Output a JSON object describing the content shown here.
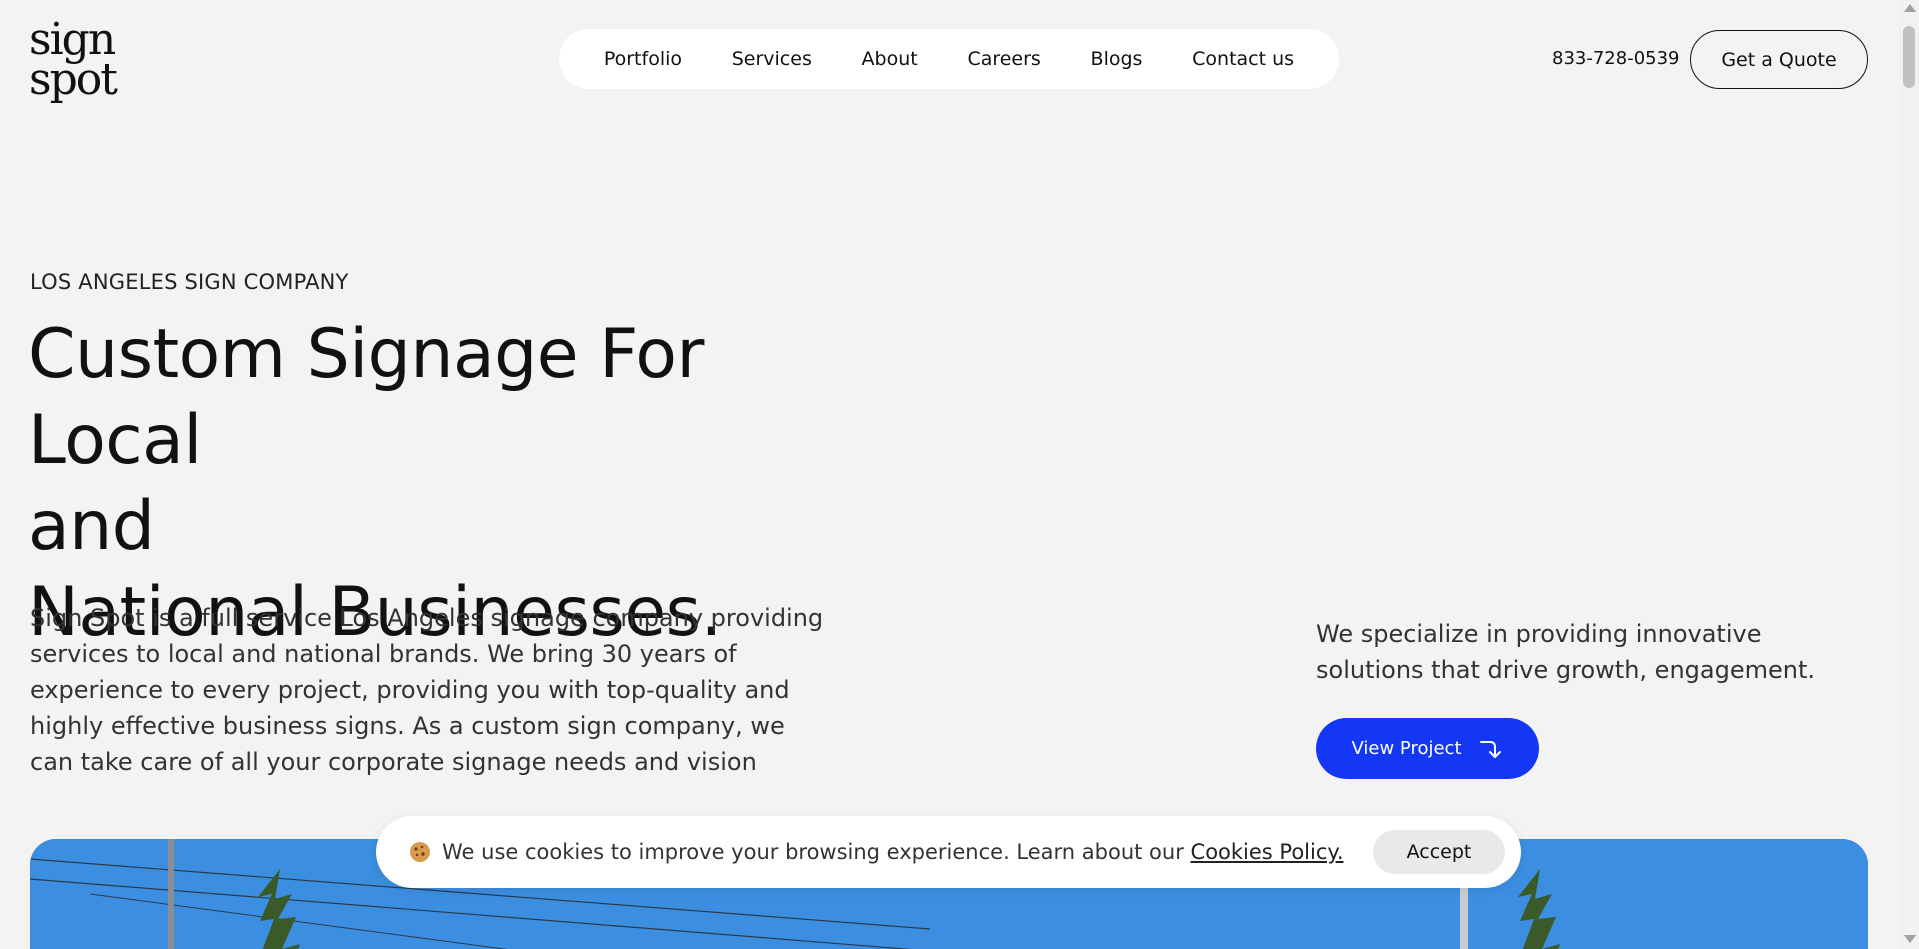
{
  "logo": {
    "line1": "sign",
    "line2": "spot"
  },
  "nav": {
    "items": [
      {
        "label": "Portfolio"
      },
      {
        "label": "Services"
      },
      {
        "label": "About"
      },
      {
        "label": "Careers"
      },
      {
        "label": "Blogs"
      },
      {
        "label": "Contact us"
      }
    ]
  },
  "header": {
    "phone": "833-728-0539",
    "quote_label": "Get a Quote"
  },
  "hero": {
    "eyebrow": "LOS ANGELES SIGN COMPANY",
    "headline_lines": [
      "Custom Signage For Local",
      "and",
      "National Businesses."
    ],
    "description": "Sign Spot is a full service Los Angeles signage company providing services to local and national brands. We bring 30 years of experience to every project, providing you with top-quality and highly effective business signs. As a custom sign company, we can take care of all your corporate signage needs and vision",
    "specialize": "We specialize in providing innovative solutions that drive growth, engagement.",
    "view_project_label": "View Project"
  },
  "cookie": {
    "text": "We use cookies to improve your browsing experience. Learn about our ",
    "link_label": "Cookies Policy.",
    "accept_label": "Accept",
    "icon": "cookie-icon"
  },
  "colors": {
    "accent": "#1436f5",
    "background": "#f3f3f3",
    "sky": "#3f90e0"
  }
}
